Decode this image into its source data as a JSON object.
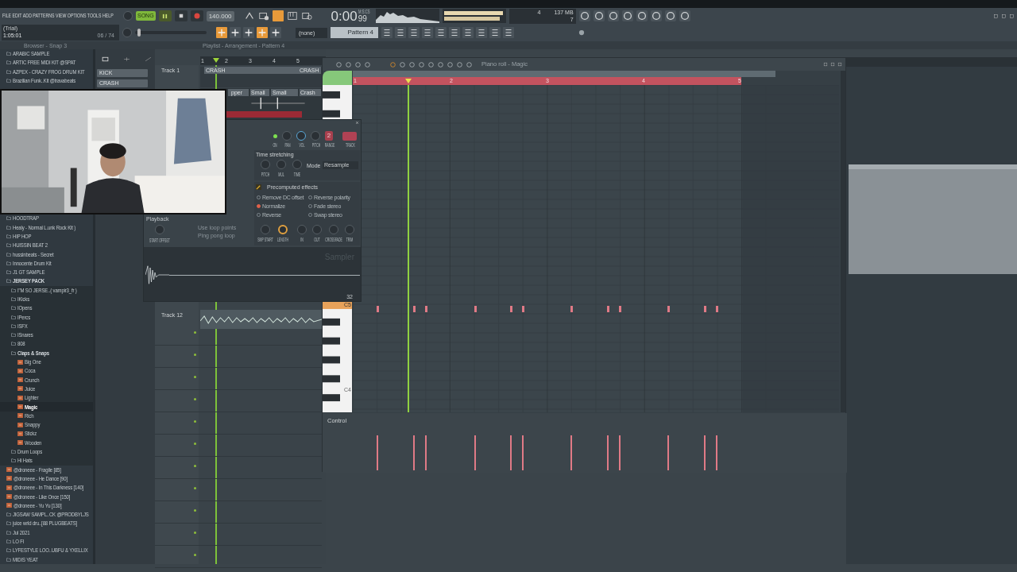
{
  "menu": [
    "FILE",
    "EDIT",
    "ADD",
    "PATTERNS",
    "VIEW",
    "OPTIONS",
    "TOOLS",
    "HELP"
  ],
  "transport": {
    "mode": "SONG",
    "playing": true,
    "tempo": "140.000",
    "time": "0:00",
    "time_fraction": "99",
    "time_unit": "M:S:CS"
  },
  "hint_panel": {
    "title": "(Trial)",
    "position": "1:05:01",
    "count": "06 / 74"
  },
  "monitor": {
    "cpu": "4",
    "memory": "137 MB",
    "polyphony": "7"
  },
  "master_pitch": {
    "level": 0.03
  },
  "pattern_bar": {
    "channel_selector": "(none)",
    "pattern": "Pattern 4"
  },
  "browser": {
    "title": "Browser - Snap 3",
    "upper_items": [
      {
        "label": "ARABIC SAMPLE",
        "kind": "folder",
        "selected": false
      },
      {
        "label": "ARTIC FREE MIDI KIT @SPAT",
        "kind": "folder",
        "selected": false
      },
      {
        "label": "AZPEX - CRAZY FROG DRUM KIT",
        "kind": "folder",
        "selected": false
      },
      {
        "label": "Brazilian Funk..Kit @travabeats",
        "kind": "folder",
        "selected": false
      }
    ],
    "lower_items": [
      {
        "label": "HOODTRAP",
        "kind": "folder",
        "selected": false
      },
      {
        "label": "Healy - Normal L.unk Rock Kit )",
        "kind": "folder",
        "selected": false
      },
      {
        "label": "HIP HOP",
        "kind": "folder",
        "selected": false
      },
      {
        "label": "HUISSIN BEAT 2",
        "kind": "folder",
        "selected": false
      },
      {
        "label": "hussinbeats - Secret",
        "kind": "folder",
        "selected": false
      },
      {
        "label": "Innocente Drum Kit",
        "kind": "folder",
        "selected": false
      },
      {
        "label": "J1 GT SAMPLE",
        "kind": "folder",
        "selected": false
      },
      {
        "label": "JERSEY PACK",
        "kind": "folder",
        "selected": false,
        "children": [
          {
            "label": "I\"M SO JERSE..( vampir3_fr )",
            "kind": "folder",
            "selected": false
          },
          {
            "label": "IKicks",
            "kind": "folder",
            "selected": false
          },
          {
            "label": "IOpens",
            "kind": "folder",
            "selected": false
          },
          {
            "label": "IPercs",
            "kind": "folder",
            "selected": false
          },
          {
            "label": "ISFX",
            "kind": "folder",
            "selected": false
          },
          {
            "label": "ISnares",
            "kind": "folder",
            "selected": false
          },
          {
            "label": "808",
            "kind": "folder",
            "selected": false
          },
          {
            "label": "Claps & Snaps",
            "kind": "folder",
            "selected": false,
            "children": [
              {
                "label": "Big One",
                "kind": "sample",
                "selected": false
              },
              {
                "label": "Coca",
                "kind": "sample",
                "selected": false
              },
              {
                "label": "Crunch",
                "kind": "sample",
                "selected": false
              },
              {
                "label": "Juice",
                "kind": "sample",
                "selected": false
              },
              {
                "label": "Lighter",
                "kind": "sample",
                "selected": false
              },
              {
                "label": "Magic",
                "kind": "sample",
                "selected": true
              },
              {
                "label": "Rich",
                "kind": "sample",
                "selected": false
              },
              {
                "label": "Snappy",
                "kind": "sample",
                "selected": false
              },
              {
                "label": "Stickz",
                "kind": "sample",
                "selected": false
              },
              {
                "label": "Wooden",
                "kind": "sample",
                "selected": false
              }
            ]
          },
          {
            "label": "Drum Loops",
            "kind": "folder",
            "selected": false
          },
          {
            "label": "Hi Hats",
            "kind": "folder",
            "selected": false
          }
        ]
      },
      {
        "label": "@droneee - Fragile [85]",
        "kind": "sample",
        "selected": false
      },
      {
        "label": "@droneee - He Dance [90]",
        "kind": "sample",
        "selected": false
      },
      {
        "label": "@droneee - In This Darkness [140]",
        "kind": "sample",
        "selected": false
      },
      {
        "label": "@droneee - Like Once [150]",
        "kind": "sample",
        "selected": false
      },
      {
        "label": "@droneee - Yu Yu [130]",
        "kind": "sample",
        "selected": false
      },
      {
        "label": "JIGSAW SAMPL..CK @PRODBYLJS",
        "kind": "folder",
        "selected": false
      },
      {
        "label": "juice wrld dru..[88 PLUGBEATS]",
        "kind": "folder",
        "selected": false
      },
      {
        "label": "Jul 2021",
        "kind": "folder",
        "selected": false
      },
      {
        "label": "LO FI",
        "kind": "folder",
        "selected": false
      },
      {
        "label": "LYFESTYLE LOO..UBFU & YXELLIX",
        "kind": "folder",
        "selected": false
      },
      {
        "label": "MIDIS YEAT",
        "kind": "folder",
        "selected": false
      }
    ]
  },
  "channel_rack": {
    "channels": [
      "KICK",
      "CRASH"
    ]
  },
  "playlist": {
    "title": "Playlist - Arrangement - Pattern 4",
    "bars": [
      "1",
      "2",
      "3",
      "4",
      "5"
    ],
    "tracks": [
      "Track 1",
      "Track 12"
    ],
    "clips": [
      "CRASH",
      "CRASH",
      "pper",
      "Small",
      "Small",
      "Crash"
    ]
  },
  "sampler": {
    "title": "Sampler",
    "header_knobs": [
      "ON",
      "PAN",
      "VOL",
      "PITCH"
    ],
    "range": "2",
    "range_label": "RANGE",
    "track_label": "TRACK",
    "time_stretching": {
      "title": "Time stretching",
      "knobs": [
        "PITCH",
        "MUL",
        "TIME"
      ],
      "mode_label": "Mode",
      "mode": "Resample"
    },
    "precomputed": {
      "title": "Precomputed effects",
      "options": [
        {
          "label": "Remove DC offset",
          "on": false
        },
        {
          "label": "Reverse polarity",
          "on": false
        },
        {
          "label": "Normalize",
          "on": true
        },
        {
          "label": "Fade stereo",
          "on": false
        },
        {
          "label": "Reverse",
          "on": false
        },
        {
          "label": "Swap stereo",
          "on": false
        }
      ]
    },
    "knobs": [
      {
        "label": "SMP START",
        "active": false
      },
      {
        "label": "LENGTH",
        "active": true
      },
      {
        "label": "IN",
        "active": false
      },
      {
        "label": "OUT",
        "active": false
      },
      {
        "label": "CROSSFADE",
        "active": false
      },
      {
        "label": "TRIM",
        "active": false
      }
    ],
    "playback_label": "Playback",
    "loop_options": [
      "Use loop points",
      "Ping pong loop"
    ],
    "start_offset_label": "START OFFSET",
    "zoom": "32"
  },
  "piano_roll": {
    "title": "Piano roll - Magic",
    "bars": [
      "1",
      "2",
      "3",
      "4",
      "5"
    ],
    "key_label": "C5",
    "lower_key_label": "C4",
    "control_label": "Control"
  }
}
